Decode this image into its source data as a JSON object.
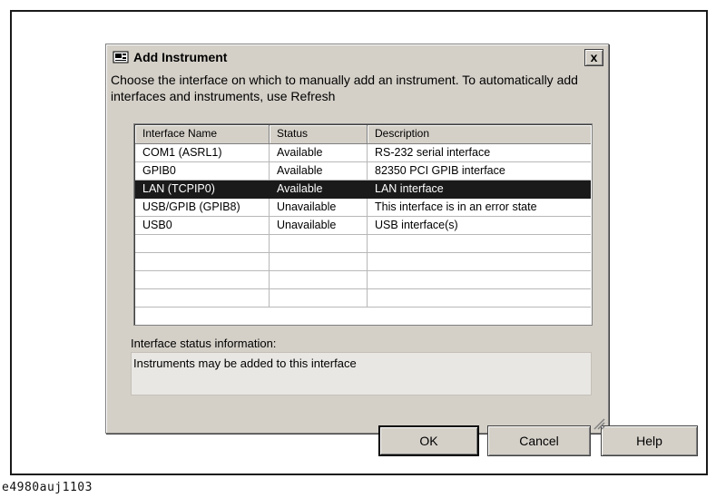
{
  "dialog": {
    "title": "Add Instrument",
    "close_label": "x",
    "instructions": "Choose the interface on which to manually add an instrument.  To automatically add interfaces and instruments, use Refresh"
  },
  "table": {
    "columns": [
      "Interface Name",
      "Status",
      "Description"
    ],
    "rows": [
      {
        "name": "COM1 (ASRL1)",
        "status": "Available",
        "description": "RS-232 serial interface",
        "selected": false
      },
      {
        "name": "GPIB0",
        "status": "Available",
        "description": "82350 PCI GPIB interface",
        "selected": false
      },
      {
        "name": "LAN (TCPIP0)",
        "status": "Available",
        "description": "LAN interface",
        "selected": true
      },
      {
        "name": "USB/GPIB (GPIB8)",
        "status": "Unavailable",
        "description": "This interface is in an error state",
        "selected": false
      },
      {
        "name": "USB0",
        "status": "Unavailable",
        "description": "USB interface(s)",
        "selected": false
      },
      {
        "name": "",
        "status": "",
        "description": "",
        "selected": false
      },
      {
        "name": "",
        "status": "",
        "description": "",
        "selected": false
      },
      {
        "name": "",
        "status": "",
        "description": "",
        "selected": false
      },
      {
        "name": "",
        "status": "",
        "description": "",
        "selected": false
      }
    ]
  },
  "status_section": {
    "label": "Interface status information:",
    "text": "Instruments may be added to this interface"
  },
  "buttons": {
    "ok": "OK",
    "cancel": "Cancel",
    "help": "Help"
  },
  "caption": "e4980auj1103",
  "colors": {
    "dialog_bg": "#d4d0c8",
    "selection_bg": "#1a1a1a"
  }
}
